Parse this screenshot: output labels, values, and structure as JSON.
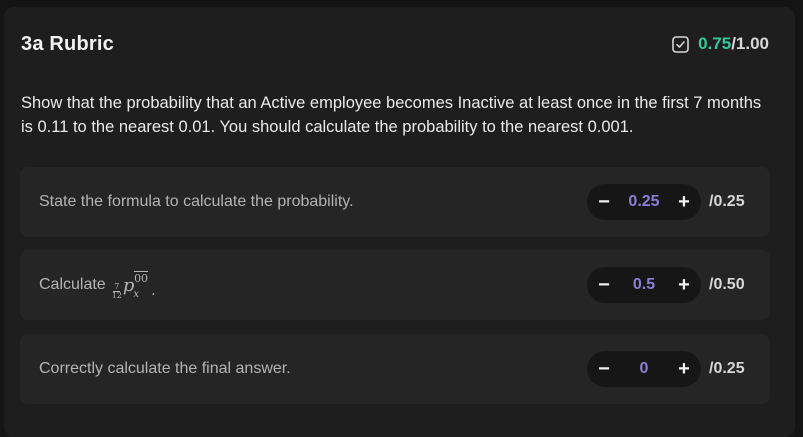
{
  "rubric": {
    "title": "3a Rubric",
    "score_earned": "0.75",
    "score_total": "/1.00",
    "score_icon": "checkbox-check-icon",
    "accent_color": "#34c79a",
    "question": "Show that the probability that an Active employee becomes Inactive at least once in the first 7 months is 0.11 to the nearest 0.01. You should calculate the probability to the nearest 0.001."
  },
  "criteria": [
    {
      "label": "State the formula to calculate the probability.",
      "value": "0.25",
      "max": "/0.25",
      "decrement": "−",
      "increment": "+"
    },
    {
      "label": "Calculate",
      "math": {
        "frac_num": "7",
        "frac_den": "12",
        "p": "p",
        "sub": "x",
        "sup": "00",
        "trail": "."
      },
      "value": "0.5",
      "max": "/0.50",
      "decrement": "−",
      "increment": "+"
    },
    {
      "label": "Correctly calculate the final answer.",
      "value": "0",
      "max": "/0.25",
      "decrement": "−",
      "increment": "+"
    }
  ],
  "colors": {
    "value": "#8a7fd6",
    "background": "#1e1e1f",
    "card": "#252526"
  }
}
